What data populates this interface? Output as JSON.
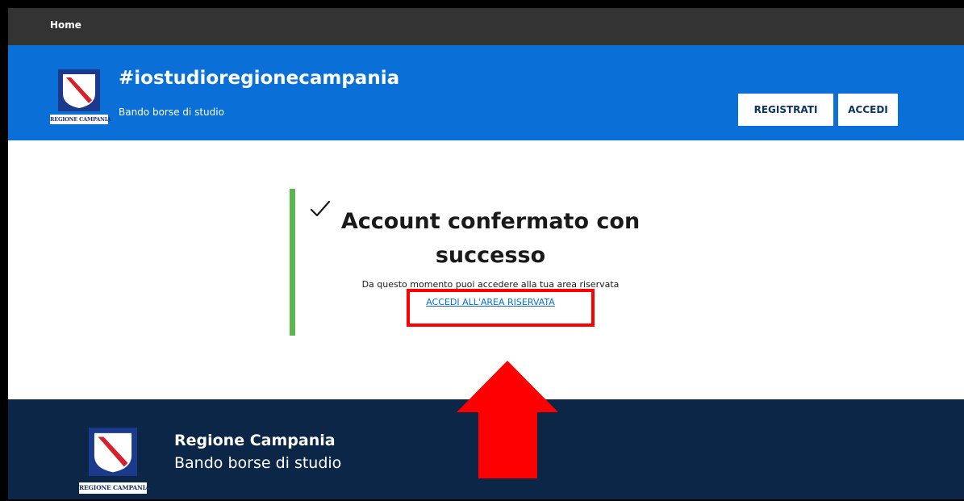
{
  "topbar": {
    "home_label": "Home"
  },
  "header": {
    "title": "#iostudioregionecampania",
    "subtitle": "Bando borse di studio",
    "logo_text": "REGIONE CAMPANIA",
    "register_label": "REGISTRATI",
    "login_label": "ACCEDI"
  },
  "main": {
    "heading": "Account confermato con successo",
    "message": "Da questo momento puoi accedere alla tua area riservata",
    "link_label": "ACCEDI ALL'AREA RISERVATA"
  },
  "footer": {
    "logo_text": "REGIONE CAMPANIA",
    "name": "Regione Campania",
    "subtitle": "Bando borse di studio"
  },
  "colors": {
    "topbar": "#333333",
    "header": "#0a6fd6",
    "footer": "#0c2647",
    "success_accent": "#5fb352",
    "annotation": "#ff0000"
  },
  "icons": [
    "checkmark-icon",
    "regione-campania-logo",
    "annotation-arrow-up"
  ]
}
